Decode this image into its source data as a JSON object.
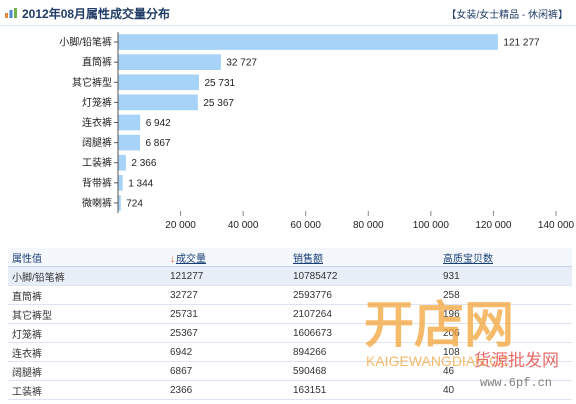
{
  "header": {
    "title": "2012年08月属性成交量分布",
    "category": "【女装/女士精品 - 休闲裤】"
  },
  "chart_data": {
    "type": "bar",
    "orientation": "horizontal",
    "categories": [
      "小脚/铅笔裤",
      "直筒裤",
      "其它裤型",
      "灯笼裤",
      "连衣裤",
      "阔腿裤",
      "工装裤",
      "背带裤",
      "微喇裤"
    ],
    "values": [
      121277,
      32727,
      25731,
      25367,
      6942,
      6867,
      2366,
      1344,
      724
    ],
    "value_labels": [
      "121 277",
      "32 727",
      "25 731",
      "25 367",
      "6 942",
      "6 867",
      "2 366",
      "1 344",
      "724"
    ],
    "xlim": [
      0,
      140000
    ],
    "xticks": [
      20000,
      40000,
      60000,
      80000,
      100000,
      120000,
      140000
    ],
    "xtick_labels": [
      "20 000",
      "40 000",
      "60 000",
      "80 000",
      "100 000",
      "120 000",
      "140 000"
    ],
    "grid": false,
    "bar_color": "#a6d3f7"
  },
  "table": {
    "headers": [
      "属性值",
      "成交量",
      "销售额",
      "高质宝贝数"
    ],
    "sort_arrow": "↓",
    "rows": [
      [
        "小脚/铅笔裤",
        "121277",
        "10785472",
        "931"
      ],
      [
        "直筒裤",
        "32727",
        "2593776",
        "258"
      ],
      [
        "其它裤型",
        "25731",
        "2107264",
        "196"
      ],
      [
        "灯笼裤",
        "25367",
        "1606673",
        "206"
      ],
      [
        "连衣裤",
        "6942",
        "894266",
        "108"
      ],
      [
        "阔腿裤",
        "6867",
        "590468",
        "46"
      ],
      [
        "工装裤",
        "2366",
        "163151",
        "40"
      ]
    ]
  },
  "watermark": {
    "logo_text": "开店网",
    "latin": "KAIGEWANGDIAN.CC",
    "slogan": "货源批发网",
    "url": "www.6pf.cn"
  }
}
